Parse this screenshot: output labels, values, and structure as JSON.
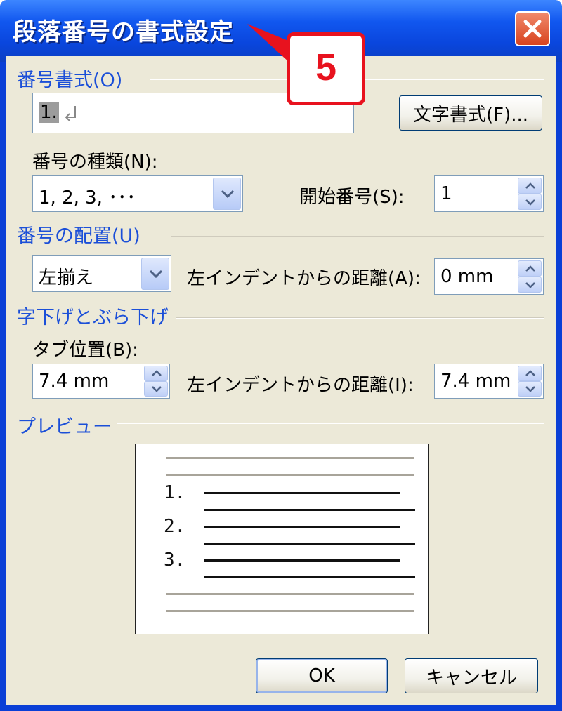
{
  "window": {
    "title": "段落番号の書式設定",
    "close_icon": "close-icon"
  },
  "callout": {
    "number": "5",
    "color": "#e8121e"
  },
  "number_format": {
    "section_label": "番号書式(O)",
    "value": "1.",
    "font_button": "文字書式(F)..."
  },
  "number_style": {
    "label": "番号の種類(N):",
    "value": "1, 2, 3, ･･･"
  },
  "start_at": {
    "label": "開始番号(S):",
    "value": "1"
  },
  "number_position": {
    "section_label": "番号の配置(U)",
    "alignment_value": "左揃え",
    "aligned_at_label": "左インデントからの距離(A):",
    "aligned_at_value": "0 mm"
  },
  "text_position": {
    "section_label": "字下げとぶら下げ",
    "tab_label": "タブ位置(B):",
    "tab_value": "7.4 mm",
    "indent_label": "左インデントからの距離(I):",
    "indent_value": "7.4 mm"
  },
  "preview": {
    "section_label": "プレビュー",
    "items": [
      "1.",
      "2.",
      "3."
    ]
  },
  "buttons": {
    "ok": "OK",
    "cancel": "キャンセル"
  },
  "colors": {
    "titlebar": "#0a46dd",
    "section_text": "#1b4fd8",
    "dialog_bg": "#ece9d8"
  }
}
